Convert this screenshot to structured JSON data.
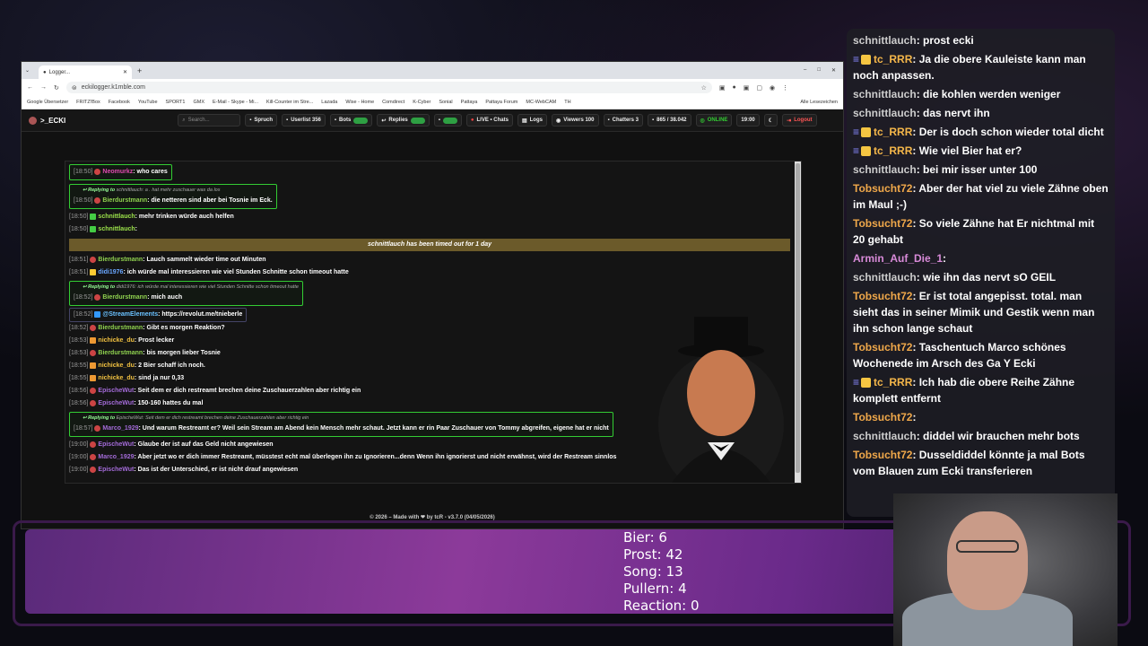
{
  "browser": {
    "tab_title": "Logger...",
    "new_tab": "+",
    "url": "eckilogger.k1mble.com",
    "bookmarks": [
      "Google Übersetzer",
      "FRITZ!Box",
      "Facebook",
      "YouTube",
      "SPORT1",
      "GMX",
      "E-Mail - Skype - Mi...",
      "Kill-Counter im Stre...",
      "Lazada",
      "Wise - Home",
      "Comdirect",
      "K-Cyber",
      "Sonial",
      "Pattaya",
      "Pattaya Forum",
      "MC-WebCAM",
      "TH",
      "Alle Lesezeichen"
    ]
  },
  "app": {
    "logo": ">_ECKI",
    "search_placeholder": "Search...",
    "nav": {
      "spruch": "Spruch",
      "userlist": "Userlist 356",
      "bots": "Bots",
      "replies": "Replies",
      "live": "LIVE • Chats",
      "logs": "Logs",
      "viewers": "Viewers 100",
      "chatters": "Chatters 3",
      "stats": "865 / 38.042",
      "online": "ONLINE",
      "time": "19:00",
      "logout": "Logout"
    },
    "footer": "© 2026 – Made with ❤ by tcR - v3.7.0 (04/05/2026)"
  },
  "chat": [
    {
      "ts": "[18:50]",
      "user": "Neomurkz",
      "color": "#e04ab0",
      "text": ": who cares",
      "reply_box": true
    },
    {
      "reply_to": "schnittlauch: a . hat mehr zuschauer was da los",
      "ts": "[18:50]",
      "user": "Bierdurstmann",
      "color": "#8fd14f",
      "text": ": die netteren sind aber bei Tosnie im Eck.",
      "reply_box": true
    },
    {
      "ts": "[18:50]",
      "user": "schnittlauch",
      "color": "#9be24a",
      "text": ": mehr trinken würde auch helfen"
    },
    {
      "ts": "[18:50]",
      "user": "schnittlauch",
      "color": "#9be24a",
      "text": ":"
    },
    {
      "timeout": "schnittlauch has been timed out for 1 day"
    },
    {
      "ts": "[18:51]",
      "user": "Bierdurstmann",
      "color": "#8fd14f",
      "text": ": Lauch sammelt wieder time out Minuten"
    },
    {
      "ts": "[18:51]",
      "user": "didi1976",
      "color": "#6aa7ff",
      "text": ": ich würde mal interessieren wie viel Stunden Schnitte schon timeout hatte"
    },
    {
      "reply_to": "didi1976: ich würde mal interessieren wie viel Stunden Schnitte schon timeout hatte",
      "ts": "[18:52]",
      "user": "Bierdurstmann",
      "color": "#8fd14f",
      "text": ": mich auch",
      "reply_box": true
    },
    {
      "ts": "[18:52]",
      "user": "@StreamElements",
      "color": "#6ac1ff",
      "text": ": https://revolut.me/tnieberle",
      "link_box": true
    },
    {
      "ts": "[18:52]",
      "user": "Bierdurstmann",
      "color": "#8fd14f",
      "text": ": Gibt es morgen Reaktion?"
    },
    {
      "ts": "[18:53]",
      "user": "nichicke_du",
      "color": "#f0c040",
      "text": ": Prost lecker"
    },
    {
      "ts": "[18:53]",
      "user": "Bierdurstmann",
      "color": "#8fd14f",
      "text": ": bis morgen lieber Tosnie"
    },
    {
      "ts": "[18:55]",
      "user": "nichicke_du",
      "color": "#f0c040",
      "text": ": 2 Bier schaff ich noch."
    },
    {
      "ts": "[18:55]",
      "user": "nichicke_du",
      "color": "#f0c040",
      "text": ": sind ja nur 0,33"
    },
    {
      "ts": "[18:56]",
      "user": "EpischeWut",
      "color": "#a36bd8",
      "text": ": Seit dem er dich restreamt brechen deine Zuschauerzahlen aber richtig ein"
    },
    {
      "ts": "[18:56]",
      "user": "EpischeWut",
      "color": "#a36bd8",
      "text": ": 150-160 hattes du mal"
    },
    {
      "reply_to": "EpischeWut: Seit dem er dich restreamt brechen deine Zuschauerzahlen aber richtig ein",
      "ts": "[18:57]",
      "user": "Marco_1929",
      "color": "#a36bd8",
      "text": ": Und warum Restreamt er? Weil sein Stream am Abend kein Mensch mehr schaut. Jetzt kann er rin Paar Zuschauer von Tommy abgreifen, eigene hat er nicht",
      "reply_box": true
    },
    {
      "ts": "[19:00]",
      "user": "EpischeWut",
      "color": "#a36bd8",
      "text": ": Glaube der ist auf das Geld nicht angewiesen"
    },
    {
      "ts": "[19:00]",
      "user": "Marco_1929",
      "color": "#a36bd8",
      "text": ": Aber jetzt wo er dich immer Restreamt, müsstest echt mal überlegen ihn zu Ignorieren...denn Wenn ihn ignorierst und nicht erwähnst, wird der Restream sinnlos"
    },
    {
      "ts": "[19:00]",
      "user": "EpischeWut",
      "color": "#a36bd8",
      "text": ": Das ist der Unterschied, er ist nicht drauf angewiesen"
    }
  ],
  "overlay_chat": [
    {
      "user": "schnittlauch",
      "cls": "ux",
      "text": ": prost ecki"
    },
    {
      "user": "tc_RRR",
      "cls": "u2",
      "badge": true,
      "text": ": Ja die obere Kauleiste kann man noch anpassen."
    },
    {
      "user": "schnittlauch",
      "cls": "ux",
      "text": ": die kohlen werden weniger"
    },
    {
      "user": "schnittlauch",
      "cls": "ux",
      "text": ": das nervt ihn"
    },
    {
      "user": "tc_RRR",
      "cls": "u2",
      "badge": true,
      "text": ": Der is doch schon wieder total dicht"
    },
    {
      "user": "tc_RRR",
      "cls": "u2",
      "badge": true,
      "text": ": Wie viel Bier hat er?"
    },
    {
      "user": "schnittlauch",
      "cls": "ux",
      "text": ": bei mir isser unter 100"
    },
    {
      "user": "Tobsucht72",
      "cls": "u3",
      "text": ": Aber der hat viel zu viele Zähne oben im Maul ;-)"
    },
    {
      "user": "Tobsucht72",
      "cls": "u3",
      "text": ": So viele Zähne hat Er nichtmal mit 20 gehabt"
    },
    {
      "user": "Armin_Auf_Die_1",
      "cls": "u4",
      "text": ":"
    },
    {
      "user": "schnittlauch",
      "cls": "ux",
      "text": ": wie ihn das nervt sO GEIL"
    },
    {
      "user": "Tobsucht72",
      "cls": "u3",
      "text": ": Er ist total angepisst. total. man sieht das in seiner Mimik und Gestik wenn man ihn schon lange schaut"
    },
    {
      "user": "Tobsucht72",
      "cls": "u3",
      "text": ": Taschentuch Marco schönes Wochenede im Arsch des Ga Y Ecki"
    },
    {
      "user": "tc_RRR",
      "cls": "u2",
      "badge": true,
      "text": ": Ich hab die obere Reihe Zähne komplett entfernt"
    },
    {
      "user": "Tobsucht72",
      "cls": "u3",
      "text": ":"
    },
    {
      "user": "schnittlauch",
      "cls": "ux",
      "text": ": diddel wir brauchen mehr bots"
    },
    {
      "user": "Tobsucht72",
      "cls": "u3",
      "text": ": Dusseldiddel könnte ja mal Bots vom Blauen zum Ecki transferieren"
    }
  ],
  "counters": {
    "bier": "Bier:  6",
    "prost": "Prost:  42",
    "song": "Song:  13",
    "pullern": "Pullern:  4",
    "reaction": "Reaction:  0"
  }
}
